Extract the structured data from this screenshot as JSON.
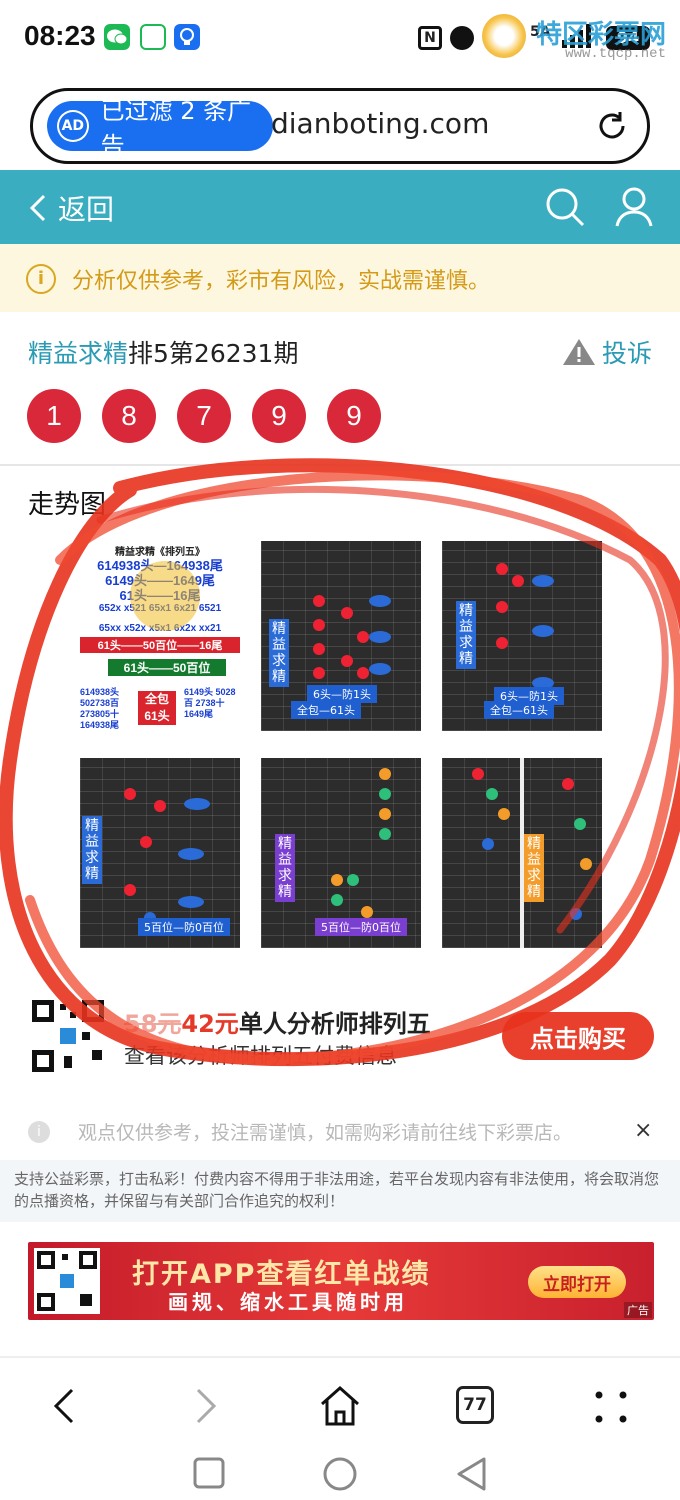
{
  "status": {
    "time": "08:23",
    "battery": "94",
    "signal_text": "5A",
    "watermark": "特区彩票网",
    "watermark_url": "www.tqcp.net"
  },
  "urlbar": {
    "ad_filter_text": "已过滤 2 条广告",
    "ad_badge": "AD",
    "domain": "dianboting.com"
  },
  "header": {
    "back_label": "返回"
  },
  "notice": {
    "icon": "i",
    "text": "分析仅供参考，彩市有风险，实战需谨慎。"
  },
  "plan": {
    "author": "精益求精",
    "title": "排5第26231期",
    "report_label": "投诉"
  },
  "numbers": [
    "1",
    "8",
    "7",
    "9",
    "9"
  ],
  "trend": {
    "label": "走势图"
  },
  "thumbs": {
    "t1_lines": [
      "精益求精《排列五》",
      "614938头—164938尾",
      "6149头——1649尾",
      "61头——16尾",
      "652x x521 65x1 6x21 6521",
      "65xx x52x x5x1 6x2x xx21",
      "61头——50百位——16尾",
      "61头——50百位",
      "614938头 502738百 273805十 164938尾",
      "全包 61头",
      "6149头 5028百 2738十 1649尾"
    ],
    "t2_label": "精益求精",
    "t2_cap": "6头—防1头",
    "t2_cap2": "全包—61头",
    "t3_label": "精益求精",
    "t3_cap": "6头—防1头",
    "t3_cap2": "全包—61头",
    "t4_label": "精益求精",
    "t4_cap": "5百位—防0百位",
    "t5_label": "精益求精",
    "t5_cap": "5百位—防0百位",
    "t6_label": "精益求精"
  },
  "buy": {
    "old_price": "58元",
    "new_price": "42元",
    "desc": "单人分析师排列五",
    "sub": "查看该分析师排列五付费信息",
    "button": "点击购买"
  },
  "disclaimer": {
    "text": "观点仅供参考，投注需谨慎，如需购彩请前往线下彩票店。",
    "close": "×"
  },
  "legal": "支持公益彩票，打击私彩！付费内容不得用于非法用途，若平台发现内容有非法使用，将会取消您的点播资格，并保留与有关部门合作追究的权利！",
  "banner": {
    "title": "打开APP查看红单战绩",
    "subtitle": "画规、缩水工具随时用",
    "open": "立即打开",
    "ad": "广告"
  },
  "nav": {
    "tabs_count": "77"
  },
  "colors": {
    "teal": "#3aaec0",
    "ball_red": "#d8283a",
    "accent_blue": "#2b9bb5",
    "annotation": "#e8321e"
  }
}
